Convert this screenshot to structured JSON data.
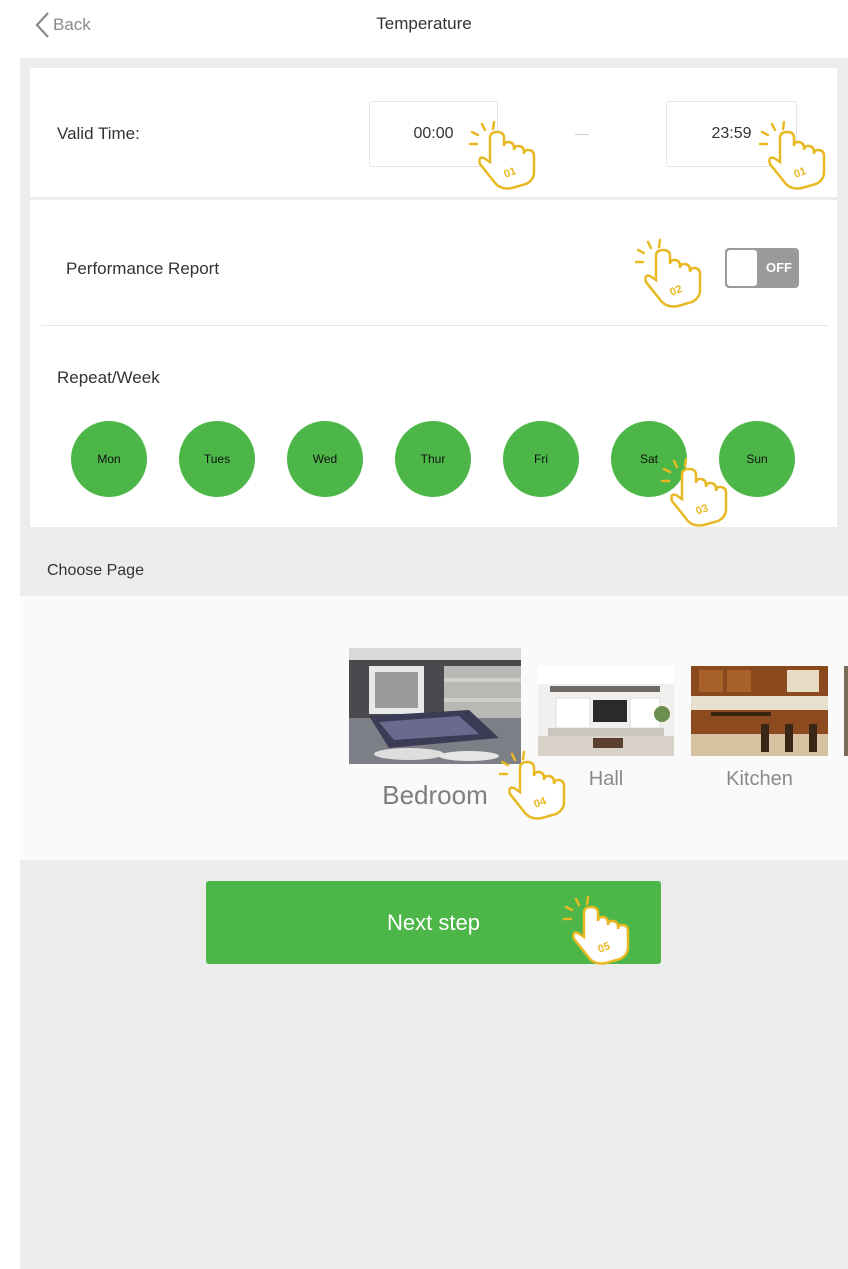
{
  "header": {
    "back_label": "Back",
    "title": "Temperature"
  },
  "valid_time": {
    "label": "Valid Time:",
    "start": "00:00",
    "end": "23:59"
  },
  "performance_report": {
    "label": "Performance Report",
    "toggle_state": "OFF"
  },
  "repeat": {
    "label": "Repeat/Week",
    "days": [
      "Mon",
      "Tues",
      "Wed",
      "Thur",
      "Fri",
      "Sat",
      "Sun"
    ]
  },
  "choose_page": {
    "label": "Choose Page",
    "pages": [
      "Bedroom",
      "Hall",
      "Kitchen"
    ],
    "selected": "Bedroom"
  },
  "next_button": {
    "label": "Next step"
  },
  "hints": [
    "01",
    "01",
    "02",
    "03",
    "04",
    "05"
  ],
  "colors": {
    "accent": "#4cb748",
    "hint": "#e8b923",
    "toggle_off": "#9a9a9a",
    "background": "#ececec"
  }
}
